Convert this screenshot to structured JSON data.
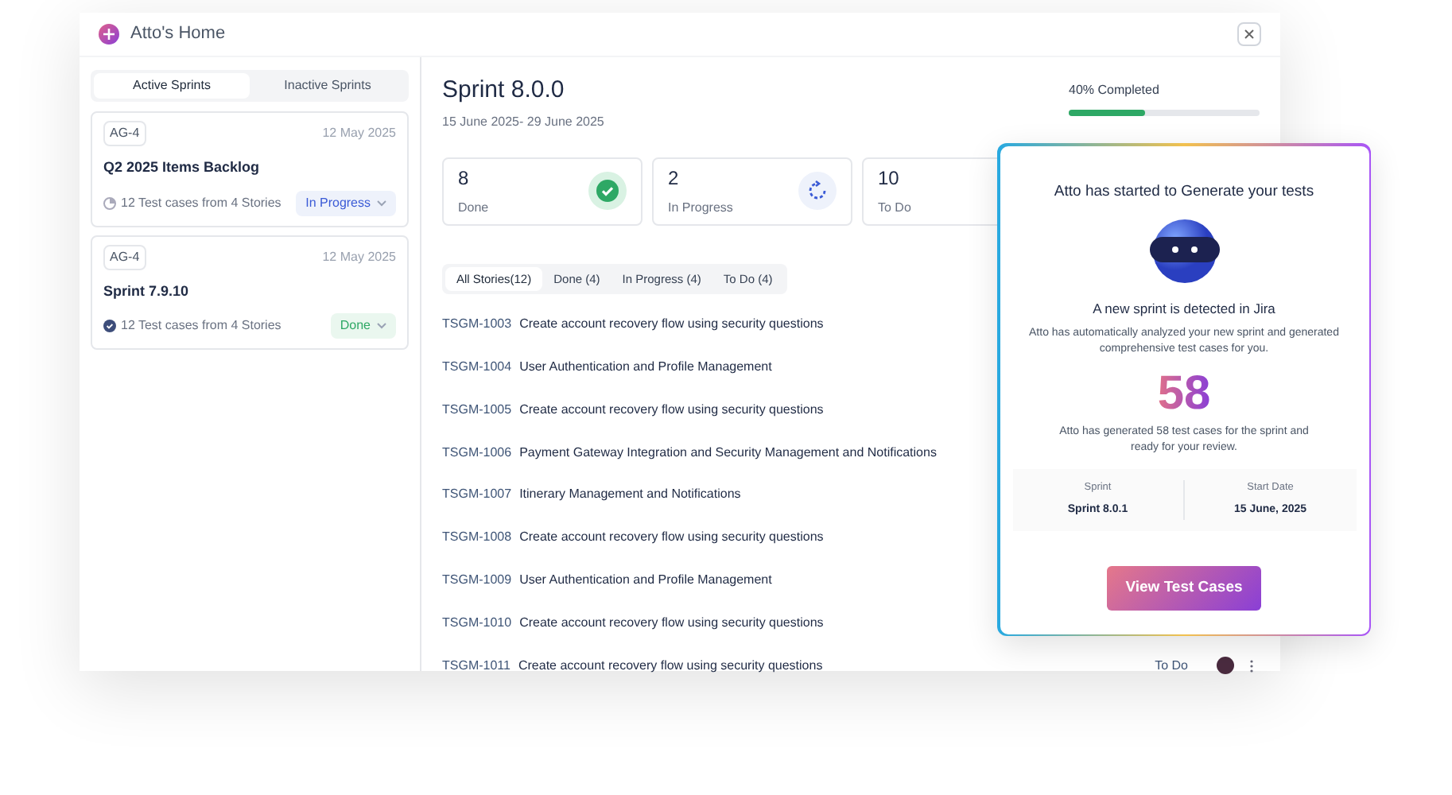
{
  "window": {
    "title": "Atto's Home"
  },
  "sidebar": {
    "tabs": [
      {
        "label": "Active Sprints",
        "selected": true
      },
      {
        "label": "Inactive Sprints",
        "selected": false
      }
    ],
    "sprints": [
      {
        "tag": "AG-4",
        "date": "12 May 2025",
        "name": "Q2 2025 Items Backlog",
        "summary": "12 Test cases from 4 Stories",
        "status": "In Progress",
        "kind": "progress"
      },
      {
        "tag": "AG-4",
        "date": "12 May 2025",
        "name": "Sprint 7.9.10",
        "summary": "12 Test cases from 4 Stories",
        "status": "Done",
        "kind": "done"
      }
    ]
  },
  "sprint": {
    "title": "Sprint 8.0.0",
    "dates": "15 June 2025- 29 June 2025",
    "progress_label": "40% Completed",
    "level": 0.4
  },
  "stats": [
    {
      "value": "8",
      "label": "Done",
      "kind": "done"
    },
    {
      "value": "2",
      "label": "In Progress",
      "kind": "progress"
    },
    {
      "value": "10",
      "label": "To Do",
      "kind": "todo"
    }
  ],
  "story_tabs": [
    {
      "label": "All Stories(12)",
      "selected": true
    },
    {
      "label": "Done (4)",
      "selected": false
    },
    {
      "label": "In Progress (4)",
      "selected": false
    },
    {
      "label": "To Do (4)",
      "selected": false
    }
  ],
  "stories": [
    {
      "id": "TSGM-1003",
      "title": "Create account recovery flow using security questions"
    },
    {
      "id": "TSGM-1004",
      "title": "User Authentication and Profile Management"
    },
    {
      "id": "TSGM-1005",
      "title": "Create account recovery flow using security questions"
    },
    {
      "id": "TSGM-1006",
      "title": "Payment Gateway Integration and Security Management and Notifications"
    },
    {
      "id": "TSGM-1007",
      "title": "Itinerary Management and Notifications"
    },
    {
      "id": "TSGM-1008",
      "title": "Create account recovery flow using security questions"
    },
    {
      "id": "TSGM-1009",
      "title": "User Authentication and Profile Management"
    },
    {
      "id": "TSGM-1010",
      "title": "Create account recovery flow using security questions"
    },
    {
      "id": "TSGM-1011",
      "title": "Create account recovery flow using security questions",
      "status": "To Do"
    }
  ],
  "popup": {
    "title": "Atto has started to Generate your tests",
    "heading": "A new sprint is detected in Jira",
    "text": "Atto has automatically analyzed your new sprint and generated comprehensive test cases for you.",
    "count": "58",
    "count_text": "Atto has generated 58 test cases for the sprint and ready for your review.",
    "details": [
      {
        "label": "Sprint",
        "value": "Sprint 8.0.1"
      },
      {
        "label": "Start Date",
        "value": "15 June, 2025"
      }
    ],
    "button": "View Test Cases"
  }
}
